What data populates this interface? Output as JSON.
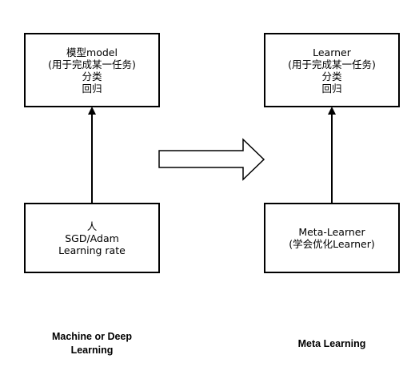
{
  "left_column": {
    "top_box": {
      "lines": [
        "模型model",
        "(用于完成某一任务)",
        "分类",
        "回归"
      ]
    },
    "bottom_box": {
      "lines": [
        "人",
        "SGD/Adam",
        "Learning rate"
      ]
    },
    "caption_lines": [
      "Machine or Deep",
      "Learning"
    ]
  },
  "right_column": {
    "top_box": {
      "lines": [
        "Learner",
        "(用于完成某一任务)",
        "分类",
        "回归"
      ]
    },
    "bottom_box": {
      "lines": [
        "Meta-Learner",
        "(学会优化Learner)"
      ]
    },
    "caption_lines": [
      "Meta Learning"
    ]
  },
  "colors": {
    "stroke": "#000000",
    "fill": "#ffffff",
    "text": "#000000"
  }
}
